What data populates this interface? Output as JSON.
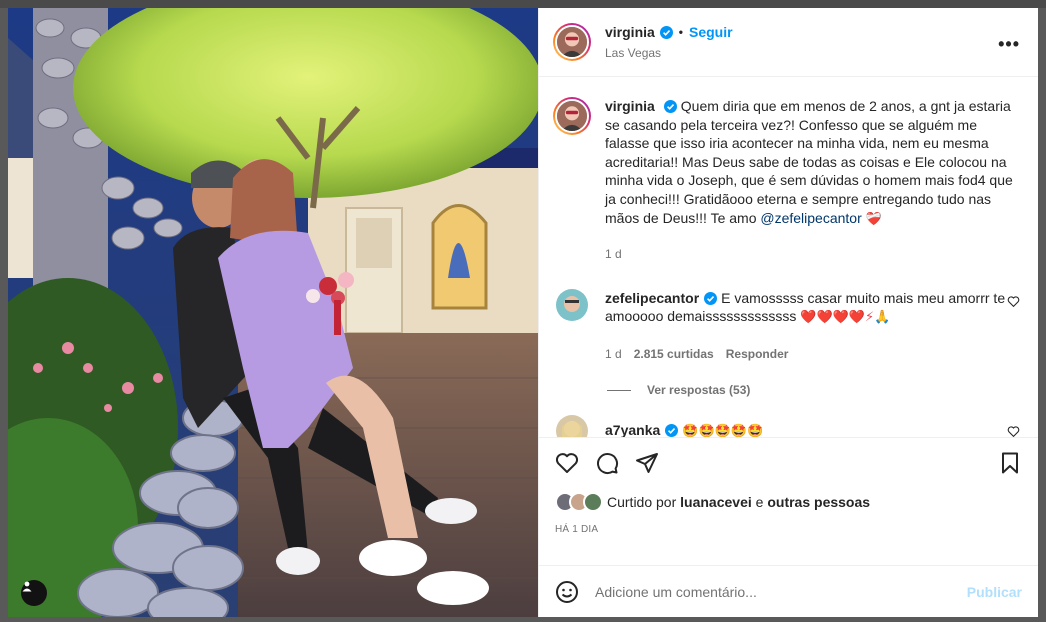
{
  "post": {
    "author": "virginia",
    "follow_label": "Seguir",
    "separator": "•",
    "location": "Las Vegas",
    "more_label": "•••"
  },
  "caption": {
    "username": "virginia",
    "text": "Quem diria que em menos de 2 anos, a gnt ja estaria se casando pela terceira vez?! Confesso que se alguém me falasse que isso iria acontecer na minha vida, nem eu mesma acreditaria!! Mas Deus sabe de todas as coisas e Ele colocou na minha vida o Joseph, que é sem dúvidas o homem mais fod4 que ja conheci!!! Gratidãooo eterna e sempre entregando tudo nas mãos de Deus!!! Te amo",
    "mention": "@zefelipecantor",
    "emoji": "❤️‍🩹",
    "time": "1 d"
  },
  "comments": [
    {
      "username": "zefelipecantor",
      "text": "E vamosssss casar muito mais meu amorrr te amooooo demaisssssssssssss",
      "emoji": "❤️❤️❤️❤️⚡🙏",
      "time": "1 d",
      "likes": "2.815 curtidas",
      "reply_label": "Responder",
      "view_replies": "Ver respostas (53)"
    },
    {
      "username": "a7yanka",
      "text": "",
      "emoji": "🤩🤩🤩🤩🤩"
    }
  ],
  "likes": {
    "prefix": "Curtido por",
    "user": "luanacevei",
    "conjunction": "e",
    "others": "outras pessoas"
  },
  "posted_time": "HÁ 1 DIA",
  "add_comment": {
    "placeholder": "Adicione um comentário...",
    "publish_label": "Publicar"
  },
  "colors": {
    "link": "#0095f6",
    "mention": "#00376b",
    "muted": "#737373",
    "publish_disabled": "#b2dffc",
    "verified": "#0095f6"
  },
  "icons": [
    "verified-badge-icon",
    "more-options-icon",
    "heart-icon",
    "comment-icon",
    "share-icon",
    "bookmark-icon",
    "emoji-icon",
    "tag-user-icon"
  ]
}
